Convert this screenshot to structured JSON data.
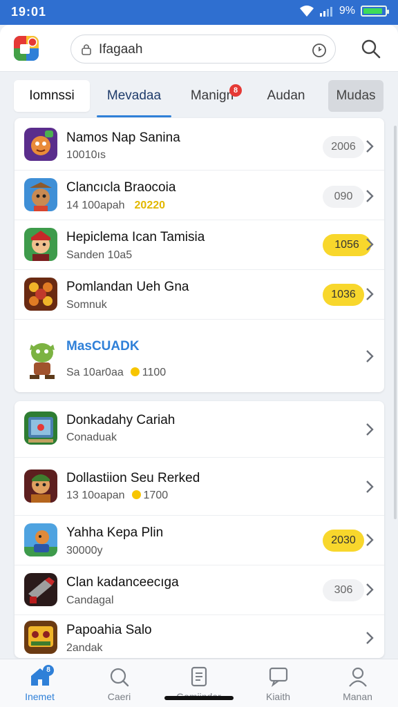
{
  "status_bar": {
    "time": "19:01",
    "battery": "9%",
    "battery_level": 0.9
  },
  "header": {
    "search_value": "Ifagaah",
    "search_placeholder": ""
  },
  "tabs": [
    {
      "label": "Iomnssi"
    },
    {
      "label": "Mevadaa"
    },
    {
      "label": "Manign",
      "badge": "8"
    },
    {
      "label": "Audan"
    },
    {
      "label": "Mudas"
    }
  ],
  "list_1": [
    {
      "title": "Namos Nap Sanina",
      "subtitle": "10010ıs",
      "badge": "2006"
    },
    {
      "title": "Clancıcla Braocoia",
      "subtitle": "14 100apah",
      "subtitle_highlight": "20220",
      "badge": "090"
    },
    {
      "title": "Hepiclema Ican Tamisia",
      "subtitle": "Sanden 10a5",
      "badge": "1056"
    },
    {
      "title": "Pomlandan Ueh Gna",
      "subtitle": "Somnuk",
      "badge": "1036"
    },
    {
      "title": "MasCUADK",
      "subtitle": "Sa 10ar0aa",
      "coin_value": "1100"
    }
  ],
  "list_2": [
    {
      "title": "Donkadahy Cariah",
      "subtitle": "Conaduak"
    },
    {
      "title": "Dollastiion Seu Rerked",
      "subtitle": "13 10oapan",
      "coin_value": "1700"
    },
    {
      "title": "Yahha Kepa Plin",
      "subtitle": "30000y",
      "badge": "2030"
    },
    {
      "title": "Clan kadanceecıga",
      "subtitle": "Candagal",
      "badge": "306"
    },
    {
      "title": "Papoahia Salo",
      "subtitle": "2andak"
    }
  ],
  "bottom_nav": [
    {
      "label": "Inemet",
      "badge": "8"
    },
    {
      "label": "Caeri"
    },
    {
      "label": "Gamiindar"
    },
    {
      "label": "Kiaith"
    },
    {
      "label": "Manan"
    }
  ],
  "colors": {
    "accent": "#2f80d8",
    "status_bar": "#2f6fd0",
    "badge_yellow": "#f8d72c",
    "coin": "#f7c500"
  },
  "icons": [
    "wifi-icon",
    "signal-icon",
    "battery-icon",
    "app-logo-icon",
    "lock-icon",
    "clock-icon",
    "search-icon",
    "chevron-right-icon",
    "home-icon",
    "discover-icon",
    "list-icon",
    "chat-icon",
    "profile-icon"
  ]
}
